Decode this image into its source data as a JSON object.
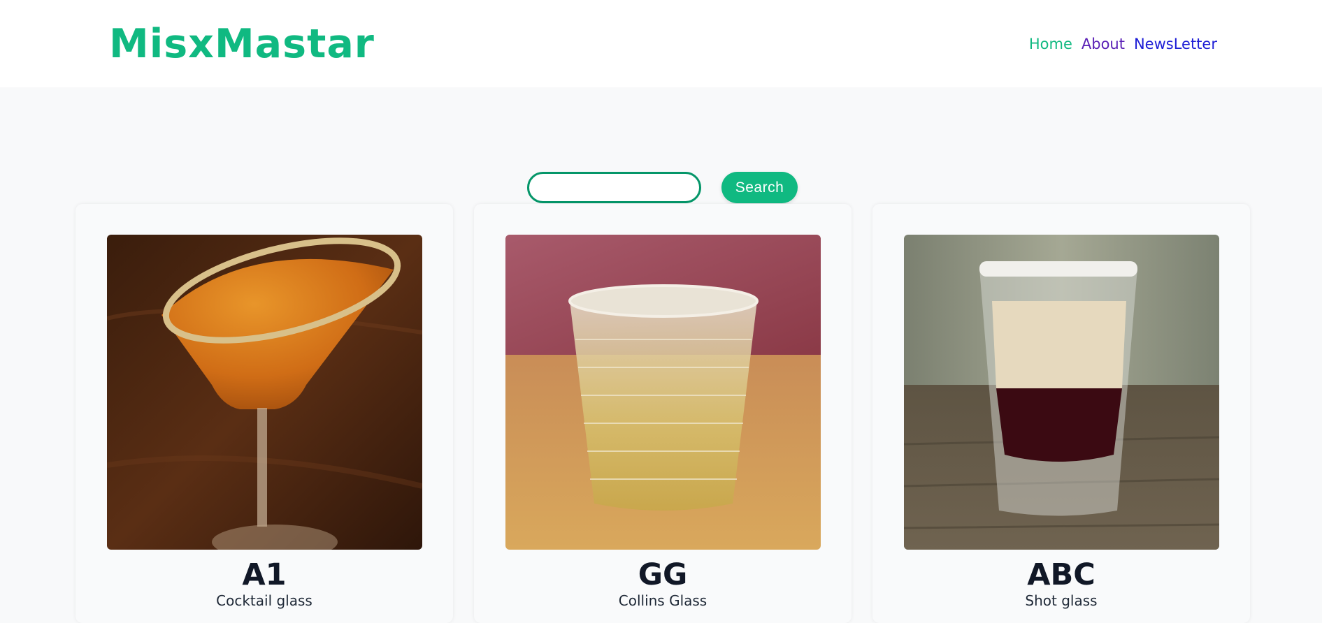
{
  "header": {
    "logo": "MisxMastar",
    "nav": {
      "home": "Home",
      "about": "About",
      "newsletter": "NewsLetter"
    }
  },
  "search": {
    "value": "",
    "placeholder": "",
    "button_label": "Search"
  },
  "cards": [
    {
      "name": "A1",
      "glass": "Cocktail glass",
      "image": "cocktail-glass-drink-photo"
    },
    {
      "name": "GG",
      "glass": "Collins Glass",
      "image": "collins-glass-drink-photo"
    },
    {
      "name": "ABC",
      "glass": "Shot glass",
      "image": "shot-glass-drink-photo"
    }
  ],
  "colors": {
    "brand": "#10b981",
    "background": "#f8f9fa"
  }
}
